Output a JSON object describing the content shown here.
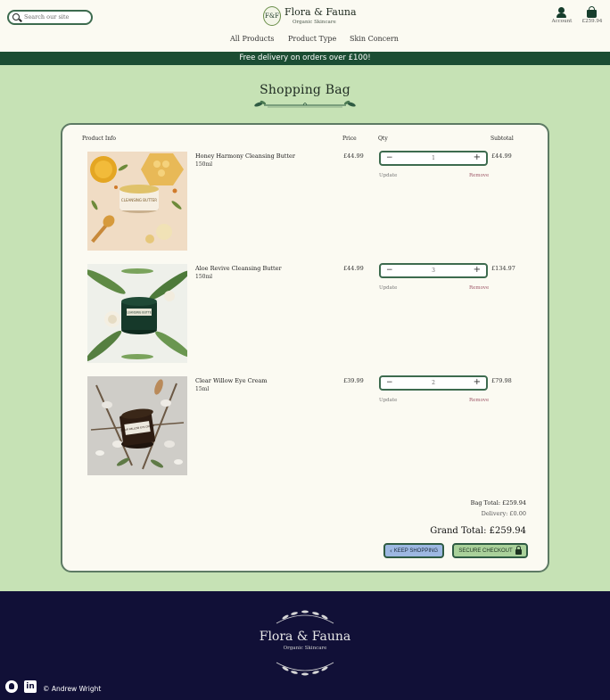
{
  "header": {
    "search_placeholder": "Search our site",
    "brand": {
      "monogram": "F&F",
      "name": "Flora & Fauna",
      "tagline": "Organic Skincare"
    },
    "nav": [
      "All Products",
      "Product Type",
      "Skin Concern"
    ],
    "account_label": "Account",
    "bag_total": "£259.94"
  },
  "promo": "Free delivery on orders over £100!",
  "page_title": "Shopping Bag",
  "table_headers": {
    "product": "Product Info",
    "price": "Price",
    "qty": "Qty",
    "subtotal": "Subtotal"
  },
  "items": [
    {
      "name": "Honey Harmony Cleansing Butter",
      "size": "150ml",
      "price": "£44.99",
      "qty": "1",
      "subtotal": "£44.99",
      "update": "Update",
      "remove": "Remove",
      "jar_label": "CLEANSING BUTTER"
    },
    {
      "name": "Aloe Revive Cleansing Butter",
      "size": "150ml",
      "price": "£44.99",
      "qty": "3",
      "subtotal": "£134.97",
      "update": "Update",
      "remove": "Remove",
      "jar_label": "CLEANSING BUTTER"
    },
    {
      "name": "Clear Willow Eye Cream",
      "size": "15ml",
      "price": "£39.99",
      "qty": "2",
      "subtotal": "£79.98",
      "update": "Update",
      "remove": "Remove",
      "jar_label": "CLEAR WILLOW EYE CREAM"
    }
  ],
  "totals": {
    "bag_total": "Bag Total: £259.94",
    "delivery": "Delivery: £0.00",
    "grand_total": "Grand Total: £259.94"
  },
  "buttons": {
    "keep_shopping": "KEEP SHOPPING",
    "secure_checkout": "SECURE CHECKOUT"
  },
  "footer": {
    "brand": "Flora & Fauna",
    "tagline": "Organic Skincare",
    "copyright": "© Andrew Wright",
    "icons": [
      "github-icon",
      "linkedin-icon"
    ]
  },
  "colors": {
    "accent": "#1b4d33",
    "background": "#c6e2b5",
    "footer": "#111037",
    "card_border": "#5d7a64"
  }
}
